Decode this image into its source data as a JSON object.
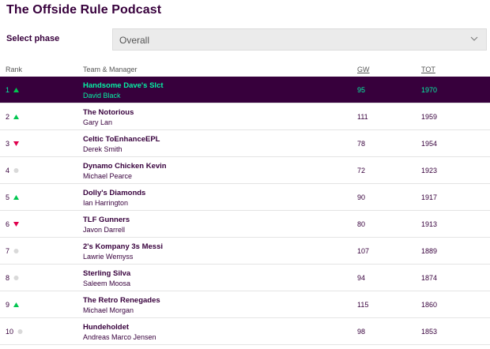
{
  "page": {
    "title": "The Offside Rule Podcast"
  },
  "phase": {
    "label": "Select phase",
    "selected": "Overall"
  },
  "table": {
    "headers": {
      "rank": "Rank",
      "team": "Team & Manager",
      "gw": "GW",
      "tot": "TOT"
    },
    "rows": [
      {
        "rank": "1",
        "movement": "up",
        "team": "Handsome Dave's Slct",
        "manager": "David Black",
        "gw": "95",
        "tot": "1970",
        "highlighted": true
      },
      {
        "rank": "2",
        "movement": "up",
        "team": "The Notorious",
        "manager": "Gary Lan",
        "gw": "111",
        "tot": "1959"
      },
      {
        "rank": "3",
        "movement": "down",
        "team": "Celtic ToEnhanceEPL",
        "manager": "Derek Smith",
        "gw": "78",
        "tot": "1954"
      },
      {
        "rank": "4",
        "movement": "same",
        "team": "Dynamo Chicken Kevin",
        "manager": "Michael Pearce",
        "gw": "72",
        "tot": "1923"
      },
      {
        "rank": "5",
        "movement": "up",
        "team": "Dolly's Diamonds",
        "manager": "Ian Harrington",
        "gw": "90",
        "tot": "1917"
      },
      {
        "rank": "6",
        "movement": "down",
        "team": "TLF Gunners",
        "manager": "Javon Darrell",
        "gw": "80",
        "tot": "1913"
      },
      {
        "rank": "7",
        "movement": "same",
        "team": "2's Kompany 3s Messi",
        "manager": "Lawrie Wemyss",
        "gw": "107",
        "tot": "1889"
      },
      {
        "rank": "8",
        "movement": "same",
        "team": "Sterling Silva",
        "manager": "Saleem Moosa",
        "gw": "94",
        "tot": "1874"
      },
      {
        "rank": "9",
        "movement": "up",
        "team": "The Retro Renegades",
        "manager": "Michael Morgan",
        "gw": "115",
        "tot": "1860"
      },
      {
        "rank": "10",
        "movement": "same",
        "team": "Hundeholdet",
        "manager": "Andreas Marco Jensen",
        "gw": "98",
        "tot": "1853"
      }
    ]
  },
  "colors": {
    "brand": "#37003c",
    "accent": "#05f0a4",
    "up": "#01c650",
    "down": "#e0004d",
    "same": "#d9d9d9"
  }
}
